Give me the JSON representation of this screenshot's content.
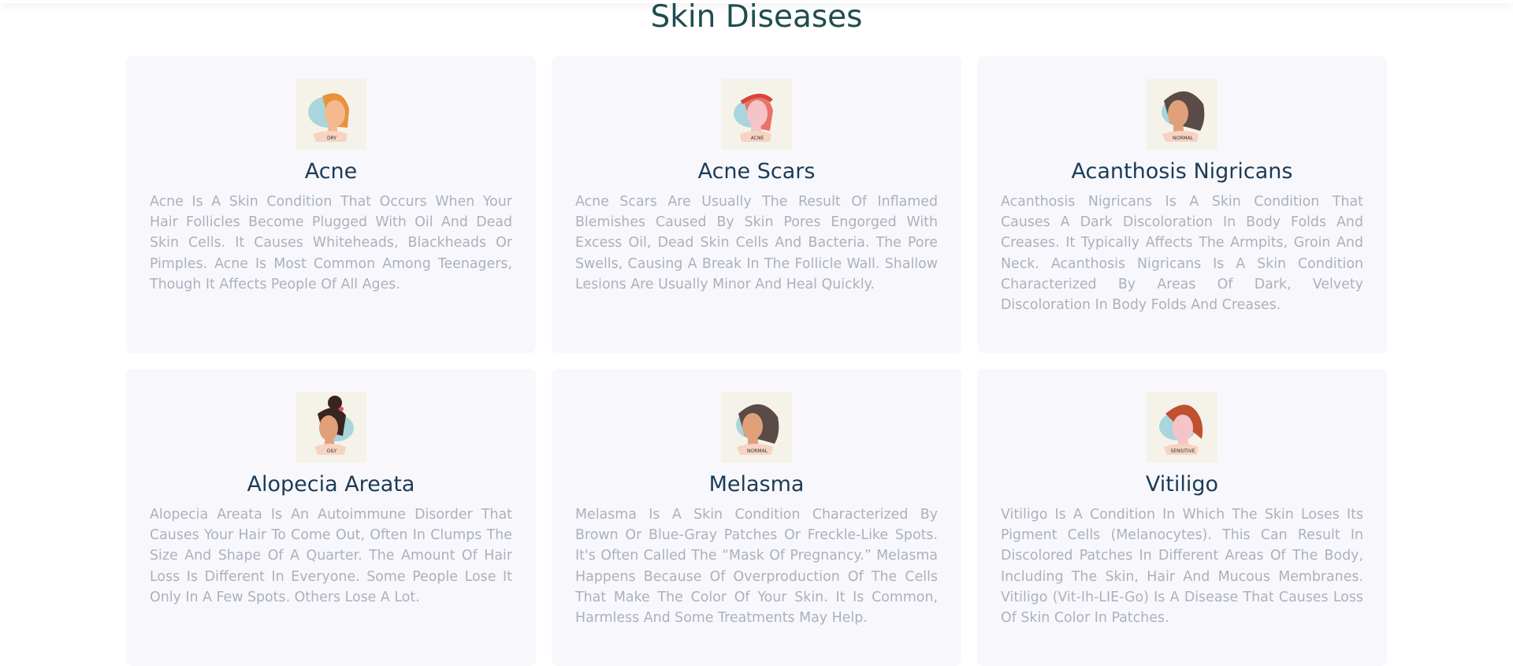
{
  "section": {
    "title": "Skin Diseases"
  },
  "cards": [
    {
      "title": "Acne",
      "badge": "DRY",
      "hair_color": "#e8923a",
      "description": "Acne Is A Skin Condition That Occurs When Your Hair Follicles Become Plugged With Oil And Dead Skin Cells. It Causes Whiteheads, Blackheads Or Pimples. Acne Is Most Common Among Teenagers, Though It Affects People Of All Ages."
    },
    {
      "title": "Acne Scars",
      "badge": "ACNE",
      "hair_color": "#e8736a",
      "description": "Acne Scars Are Usually The Result Of Inflamed Blemishes Caused By Skin Pores Engorged With Excess Oil, Dead Skin Cells And Bacteria. The Pore Swells, Causing A Break In The Follicle Wall. Shallow Lesions Are Usually Minor And Heal Quickly."
    },
    {
      "title": "Acanthosis Nigricans",
      "badge": "NORMAL",
      "hair_color": "#5a4a48",
      "description": "Acanthosis Nigricans Is A Skin Condition That Causes A Dark Discoloration In Body Folds And Creases. It Typically Affects The Armpits, Groin And Neck. Acanthosis Nigricans Is A Skin Condition Characterized By Areas Of Dark, Velvety Discoloration In Body Folds And Creases."
    },
    {
      "title": "Alopecia Areata",
      "badge": "OILY",
      "hair_color": "#3a2420",
      "description": "Alopecia Areata Is An Autoimmune Disorder That Causes Your Hair To Come Out, Often In Clumps The Size And Shape Of A Quarter. The Amount Of Hair Loss Is Different In Everyone. Some People Lose It Only In A Few Spots. Others Lose A Lot."
    },
    {
      "title": "Melasma",
      "badge": "NORMAL",
      "hair_color": "#5a4a48",
      "description": "Melasma Is A Skin Condition Characterized By Brown Or Blue-Gray Patches Or Freckle-Like Spots. It's Often Called The “Mask Of Pregnancy.” Melasma Happens Because Of Overproduction Of The Cells That Make The Color Of Your Skin. It Is Common, Harmless And Some Treatments May Help."
    },
    {
      "title": "Vitiligo",
      "badge": "SENSITIVE",
      "hair_color": "#c0502e",
      "description": "Vitiligo Is A Condition In Which The Skin Loses Its Pigment Cells (Melanocytes). This Can Result In Discolored Patches In Different Areas Of The Body, Including The Skin, Hair And Mucous Membranes. Vitiligo (Vit-Ih-LIE-Go) Is A Disease That Causes Loss Of Skin Color In Patches."
    }
  ]
}
